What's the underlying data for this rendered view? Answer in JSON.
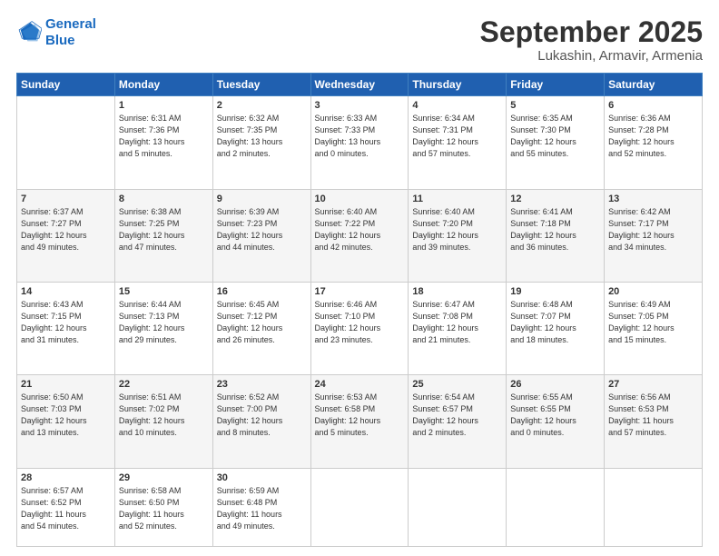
{
  "logo": {
    "line1": "General",
    "line2": "Blue"
  },
  "header": {
    "month": "September 2025",
    "location": "Lukashin, Armavir, Armenia"
  },
  "weekdays": [
    "Sunday",
    "Monday",
    "Tuesday",
    "Wednesday",
    "Thursday",
    "Friday",
    "Saturday"
  ],
  "weeks": [
    [
      {
        "day": "",
        "info": ""
      },
      {
        "day": "1",
        "info": "Sunrise: 6:31 AM\nSunset: 7:36 PM\nDaylight: 13 hours\nand 5 minutes."
      },
      {
        "day": "2",
        "info": "Sunrise: 6:32 AM\nSunset: 7:35 PM\nDaylight: 13 hours\nand 2 minutes."
      },
      {
        "day": "3",
        "info": "Sunrise: 6:33 AM\nSunset: 7:33 PM\nDaylight: 13 hours\nand 0 minutes."
      },
      {
        "day": "4",
        "info": "Sunrise: 6:34 AM\nSunset: 7:31 PM\nDaylight: 12 hours\nand 57 minutes."
      },
      {
        "day": "5",
        "info": "Sunrise: 6:35 AM\nSunset: 7:30 PM\nDaylight: 12 hours\nand 55 minutes."
      },
      {
        "day": "6",
        "info": "Sunrise: 6:36 AM\nSunset: 7:28 PM\nDaylight: 12 hours\nand 52 minutes."
      }
    ],
    [
      {
        "day": "7",
        "info": "Sunrise: 6:37 AM\nSunset: 7:27 PM\nDaylight: 12 hours\nand 49 minutes."
      },
      {
        "day": "8",
        "info": "Sunrise: 6:38 AM\nSunset: 7:25 PM\nDaylight: 12 hours\nand 47 minutes."
      },
      {
        "day": "9",
        "info": "Sunrise: 6:39 AM\nSunset: 7:23 PM\nDaylight: 12 hours\nand 44 minutes."
      },
      {
        "day": "10",
        "info": "Sunrise: 6:40 AM\nSunset: 7:22 PM\nDaylight: 12 hours\nand 42 minutes."
      },
      {
        "day": "11",
        "info": "Sunrise: 6:40 AM\nSunset: 7:20 PM\nDaylight: 12 hours\nand 39 minutes."
      },
      {
        "day": "12",
        "info": "Sunrise: 6:41 AM\nSunset: 7:18 PM\nDaylight: 12 hours\nand 36 minutes."
      },
      {
        "day": "13",
        "info": "Sunrise: 6:42 AM\nSunset: 7:17 PM\nDaylight: 12 hours\nand 34 minutes."
      }
    ],
    [
      {
        "day": "14",
        "info": "Sunrise: 6:43 AM\nSunset: 7:15 PM\nDaylight: 12 hours\nand 31 minutes."
      },
      {
        "day": "15",
        "info": "Sunrise: 6:44 AM\nSunset: 7:13 PM\nDaylight: 12 hours\nand 29 minutes."
      },
      {
        "day": "16",
        "info": "Sunrise: 6:45 AM\nSunset: 7:12 PM\nDaylight: 12 hours\nand 26 minutes."
      },
      {
        "day": "17",
        "info": "Sunrise: 6:46 AM\nSunset: 7:10 PM\nDaylight: 12 hours\nand 23 minutes."
      },
      {
        "day": "18",
        "info": "Sunrise: 6:47 AM\nSunset: 7:08 PM\nDaylight: 12 hours\nand 21 minutes."
      },
      {
        "day": "19",
        "info": "Sunrise: 6:48 AM\nSunset: 7:07 PM\nDaylight: 12 hours\nand 18 minutes."
      },
      {
        "day": "20",
        "info": "Sunrise: 6:49 AM\nSunset: 7:05 PM\nDaylight: 12 hours\nand 15 minutes."
      }
    ],
    [
      {
        "day": "21",
        "info": "Sunrise: 6:50 AM\nSunset: 7:03 PM\nDaylight: 12 hours\nand 13 minutes."
      },
      {
        "day": "22",
        "info": "Sunrise: 6:51 AM\nSunset: 7:02 PM\nDaylight: 12 hours\nand 10 minutes."
      },
      {
        "day": "23",
        "info": "Sunrise: 6:52 AM\nSunset: 7:00 PM\nDaylight: 12 hours\nand 8 minutes."
      },
      {
        "day": "24",
        "info": "Sunrise: 6:53 AM\nSunset: 6:58 PM\nDaylight: 12 hours\nand 5 minutes."
      },
      {
        "day": "25",
        "info": "Sunrise: 6:54 AM\nSunset: 6:57 PM\nDaylight: 12 hours\nand 2 minutes."
      },
      {
        "day": "26",
        "info": "Sunrise: 6:55 AM\nSunset: 6:55 PM\nDaylight: 12 hours\nand 0 minutes."
      },
      {
        "day": "27",
        "info": "Sunrise: 6:56 AM\nSunset: 6:53 PM\nDaylight: 11 hours\nand 57 minutes."
      }
    ],
    [
      {
        "day": "28",
        "info": "Sunrise: 6:57 AM\nSunset: 6:52 PM\nDaylight: 11 hours\nand 54 minutes."
      },
      {
        "day": "29",
        "info": "Sunrise: 6:58 AM\nSunset: 6:50 PM\nDaylight: 11 hours\nand 52 minutes."
      },
      {
        "day": "30",
        "info": "Sunrise: 6:59 AM\nSunset: 6:48 PM\nDaylight: 11 hours\nand 49 minutes."
      },
      {
        "day": "",
        "info": ""
      },
      {
        "day": "",
        "info": ""
      },
      {
        "day": "",
        "info": ""
      },
      {
        "day": "",
        "info": ""
      }
    ]
  ]
}
